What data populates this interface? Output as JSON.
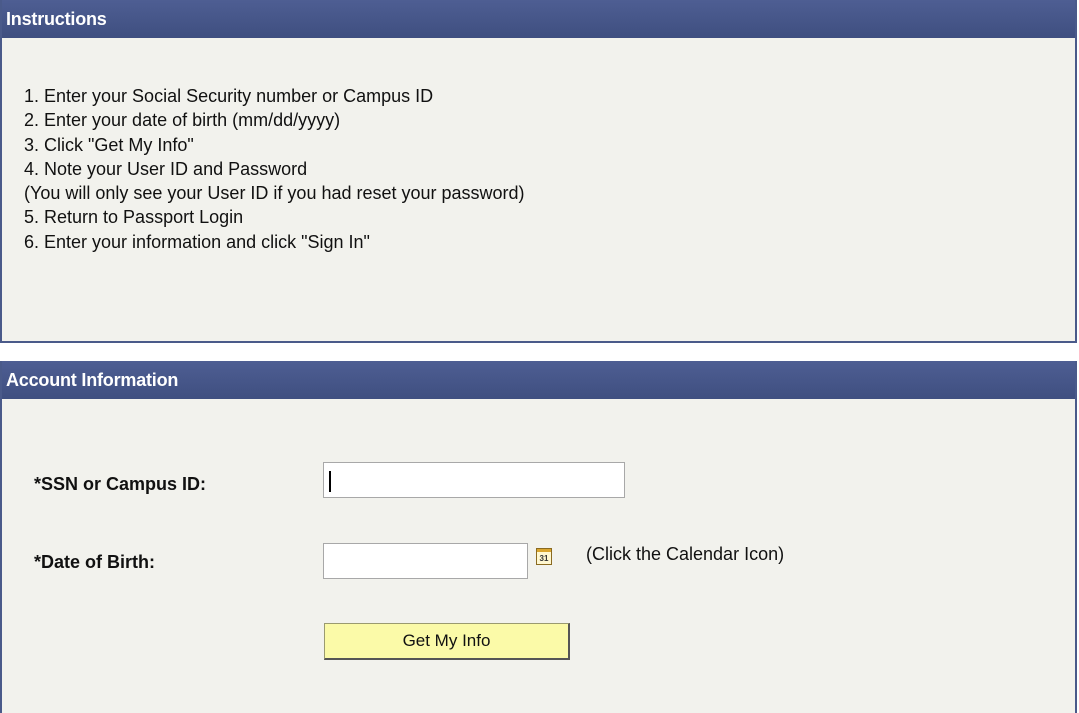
{
  "instructions": {
    "title": "Instructions",
    "items": [
      "1. Enter your Social Security number or Campus ID",
      "2. Enter your date of birth (mm/dd/yyyy)",
      "3. Click \"Get My Info\"",
      "4. Note your User ID and Password",
      "(You will only see your User ID if you had reset your password)",
      "5. Return to Passport Login",
      "6. Enter your information and click \"Sign In\""
    ]
  },
  "account": {
    "title": "Account Information",
    "ssn_label": "*SSN or Campus ID:",
    "ssn_value": "",
    "dob_label": "*Date of Birth:",
    "dob_value": "",
    "calendar_icon_text": "31",
    "calendar_hint": "(Click the Calendar Icon)",
    "submit_label": "Get My Info"
  },
  "colors": {
    "header_bg": "#4a5a8a",
    "panel_bg": "#f2f2ed",
    "button_bg": "#fbfaa8"
  },
  "icons": {
    "calendar": "calendar-icon"
  }
}
